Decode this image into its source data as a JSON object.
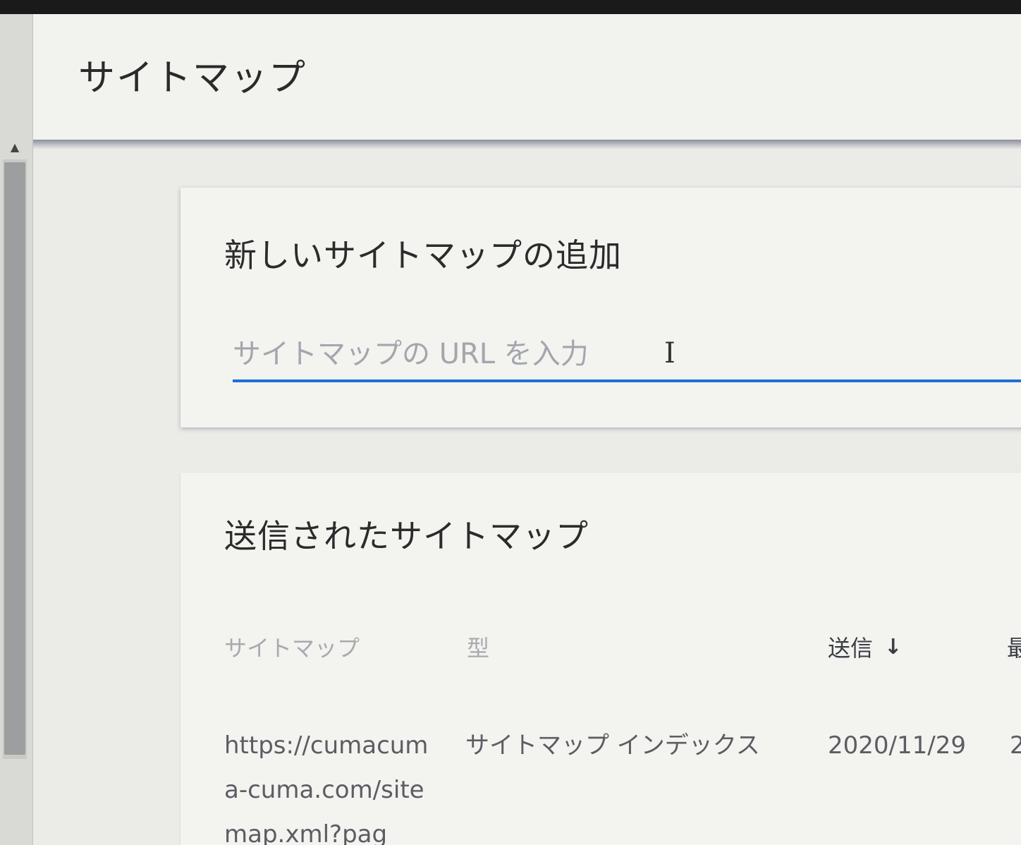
{
  "header": {
    "title": "サイトマップ"
  },
  "add_sitemap": {
    "title": "新しいサイトマップの追加",
    "input_placeholder": "サイトマップの URL を入力",
    "input_value": "",
    "accent_color": "#1f6fd6"
  },
  "submitted": {
    "title": "送信されたサイトマップ",
    "columns": {
      "sitemap": "サイトマップ",
      "type": "型",
      "submitted": "送信",
      "next": "最"
    },
    "sort_icon": "arrow-down-icon",
    "rows": [
      {
        "url": "https://cumacuma-cuma.com/sitemap.xml?pag",
        "type": "サイトマップ インデックス",
        "submitted": "2020/11/29",
        "next": "2"
      }
    ]
  }
}
